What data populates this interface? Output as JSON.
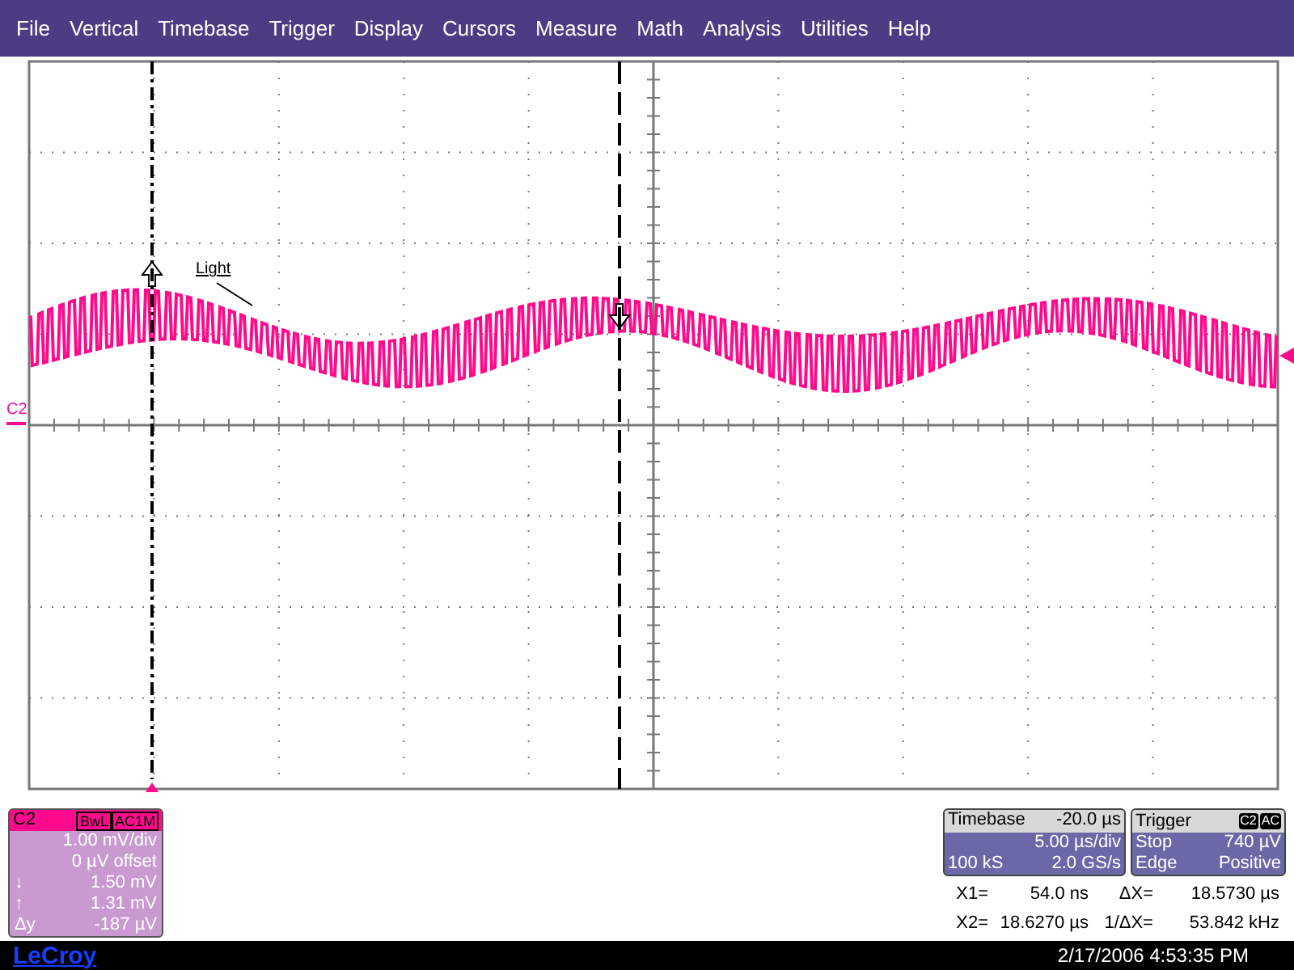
{
  "menu": [
    {
      "label": "File"
    },
    {
      "label": "Vertical"
    },
    {
      "label": "Timebase"
    },
    {
      "label": "Trigger"
    },
    {
      "label": "Display"
    },
    {
      "label": "Cursors"
    },
    {
      "label": "Measure"
    },
    {
      "label": "Math"
    },
    {
      "label": "Analysis"
    },
    {
      "label": "Utilities"
    },
    {
      "label": "Help"
    }
  ],
  "screen": {
    "trace_label": "Light",
    "channel_marker": "C2"
  },
  "channel_panel": {
    "name": "C2",
    "badges": [
      "BwL",
      "AC1M"
    ],
    "rows": [
      {
        "value": "1.00 mV/div"
      },
      {
        "value": "0 µV offset"
      },
      {
        "label": "↓",
        "value": "1.50 mV"
      },
      {
        "label": "↑",
        "value": "1.31 mV"
      },
      {
        "label": "Δy",
        "value": "-187 µV"
      }
    ]
  },
  "timebase": {
    "title": "Timebase",
    "delay": "-20.0 µs",
    "rows": [
      {
        "right": "5.00 µs/div"
      },
      {
        "left": "100 kS",
        "right": "2.0 GS/s"
      }
    ]
  },
  "trigger": {
    "title": "Trigger",
    "badges": [
      "C2",
      "AC"
    ],
    "rows": [
      {
        "left": "Stop",
        "right": "740 µV"
      },
      {
        "left": "Edge",
        "right": "Positive"
      }
    ]
  },
  "cursors": [
    {
      "label": "X1=",
      "value": "54.0 ns"
    },
    {
      "label": "ΔX=",
      "value": "18.5730 µs"
    },
    {
      "label": "X2=",
      "value": "18.6270 µs"
    },
    {
      "label": "1/ΔX=",
      "value": "53.842 kHz"
    }
  ],
  "footer": {
    "brand": "LeCroy",
    "datetime": "2/17/2006 4:53:35 PM"
  }
}
